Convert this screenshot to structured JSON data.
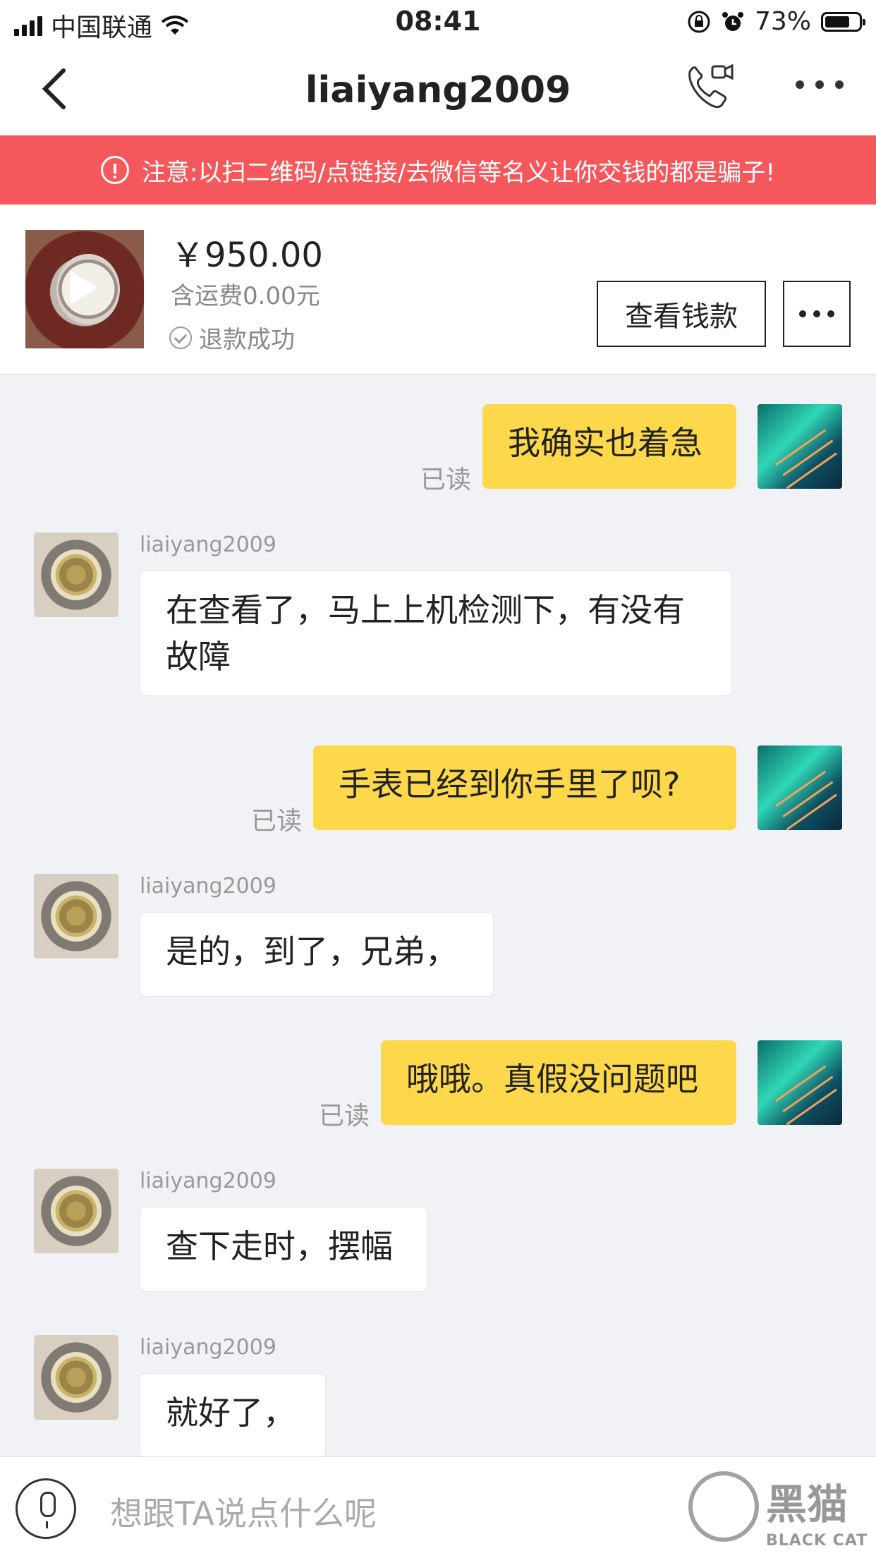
{
  "status_bar": {
    "carrier": "中国联通",
    "time": "08:41",
    "battery": "73%",
    "battery_level": 0.73
  },
  "header": {
    "title": "liaiyang2009",
    "back_icon": "chevron-left-icon",
    "call_icon": "phone-video-icon",
    "more_icon": "more-dots-icon"
  },
  "warning": {
    "text": "注意:以扫二维码/点链接/去微信等名义让你交钱的都是骗子!",
    "icon": "info-circle-icon"
  },
  "product": {
    "price": "￥950.00",
    "shipping": "含运费0.00元",
    "status": "退款成功",
    "view_money_button": "查看钱款",
    "more_button_icon": "more-dots-icon"
  },
  "messages": [
    {
      "from": "me",
      "text": "我确实也着急",
      "read": "已读"
    },
    {
      "from": "them",
      "sender": "liaiyang2009",
      "text": "在查看了，马上上机检测下，有没有故障"
    },
    {
      "from": "me",
      "text": "手表已经到你手里了呗?",
      "read": "已读"
    },
    {
      "from": "them",
      "sender": "liaiyang2009",
      "text": "是的，到了，兄弟，"
    },
    {
      "from": "me",
      "text": "哦哦。真假没问题吧",
      "read": "已读"
    },
    {
      "from": "them",
      "sender": "liaiyang2009",
      "text": "查下走时，摆幅"
    },
    {
      "from": "them",
      "sender": "liaiyang2009",
      "text": "就好了，"
    }
  ],
  "input": {
    "placeholder": "想跟TA说点什么呢",
    "mic_icon": "microphone-icon"
  },
  "watermark": {
    "title": "黑猫",
    "subtitle": "BLACK CAT"
  }
}
